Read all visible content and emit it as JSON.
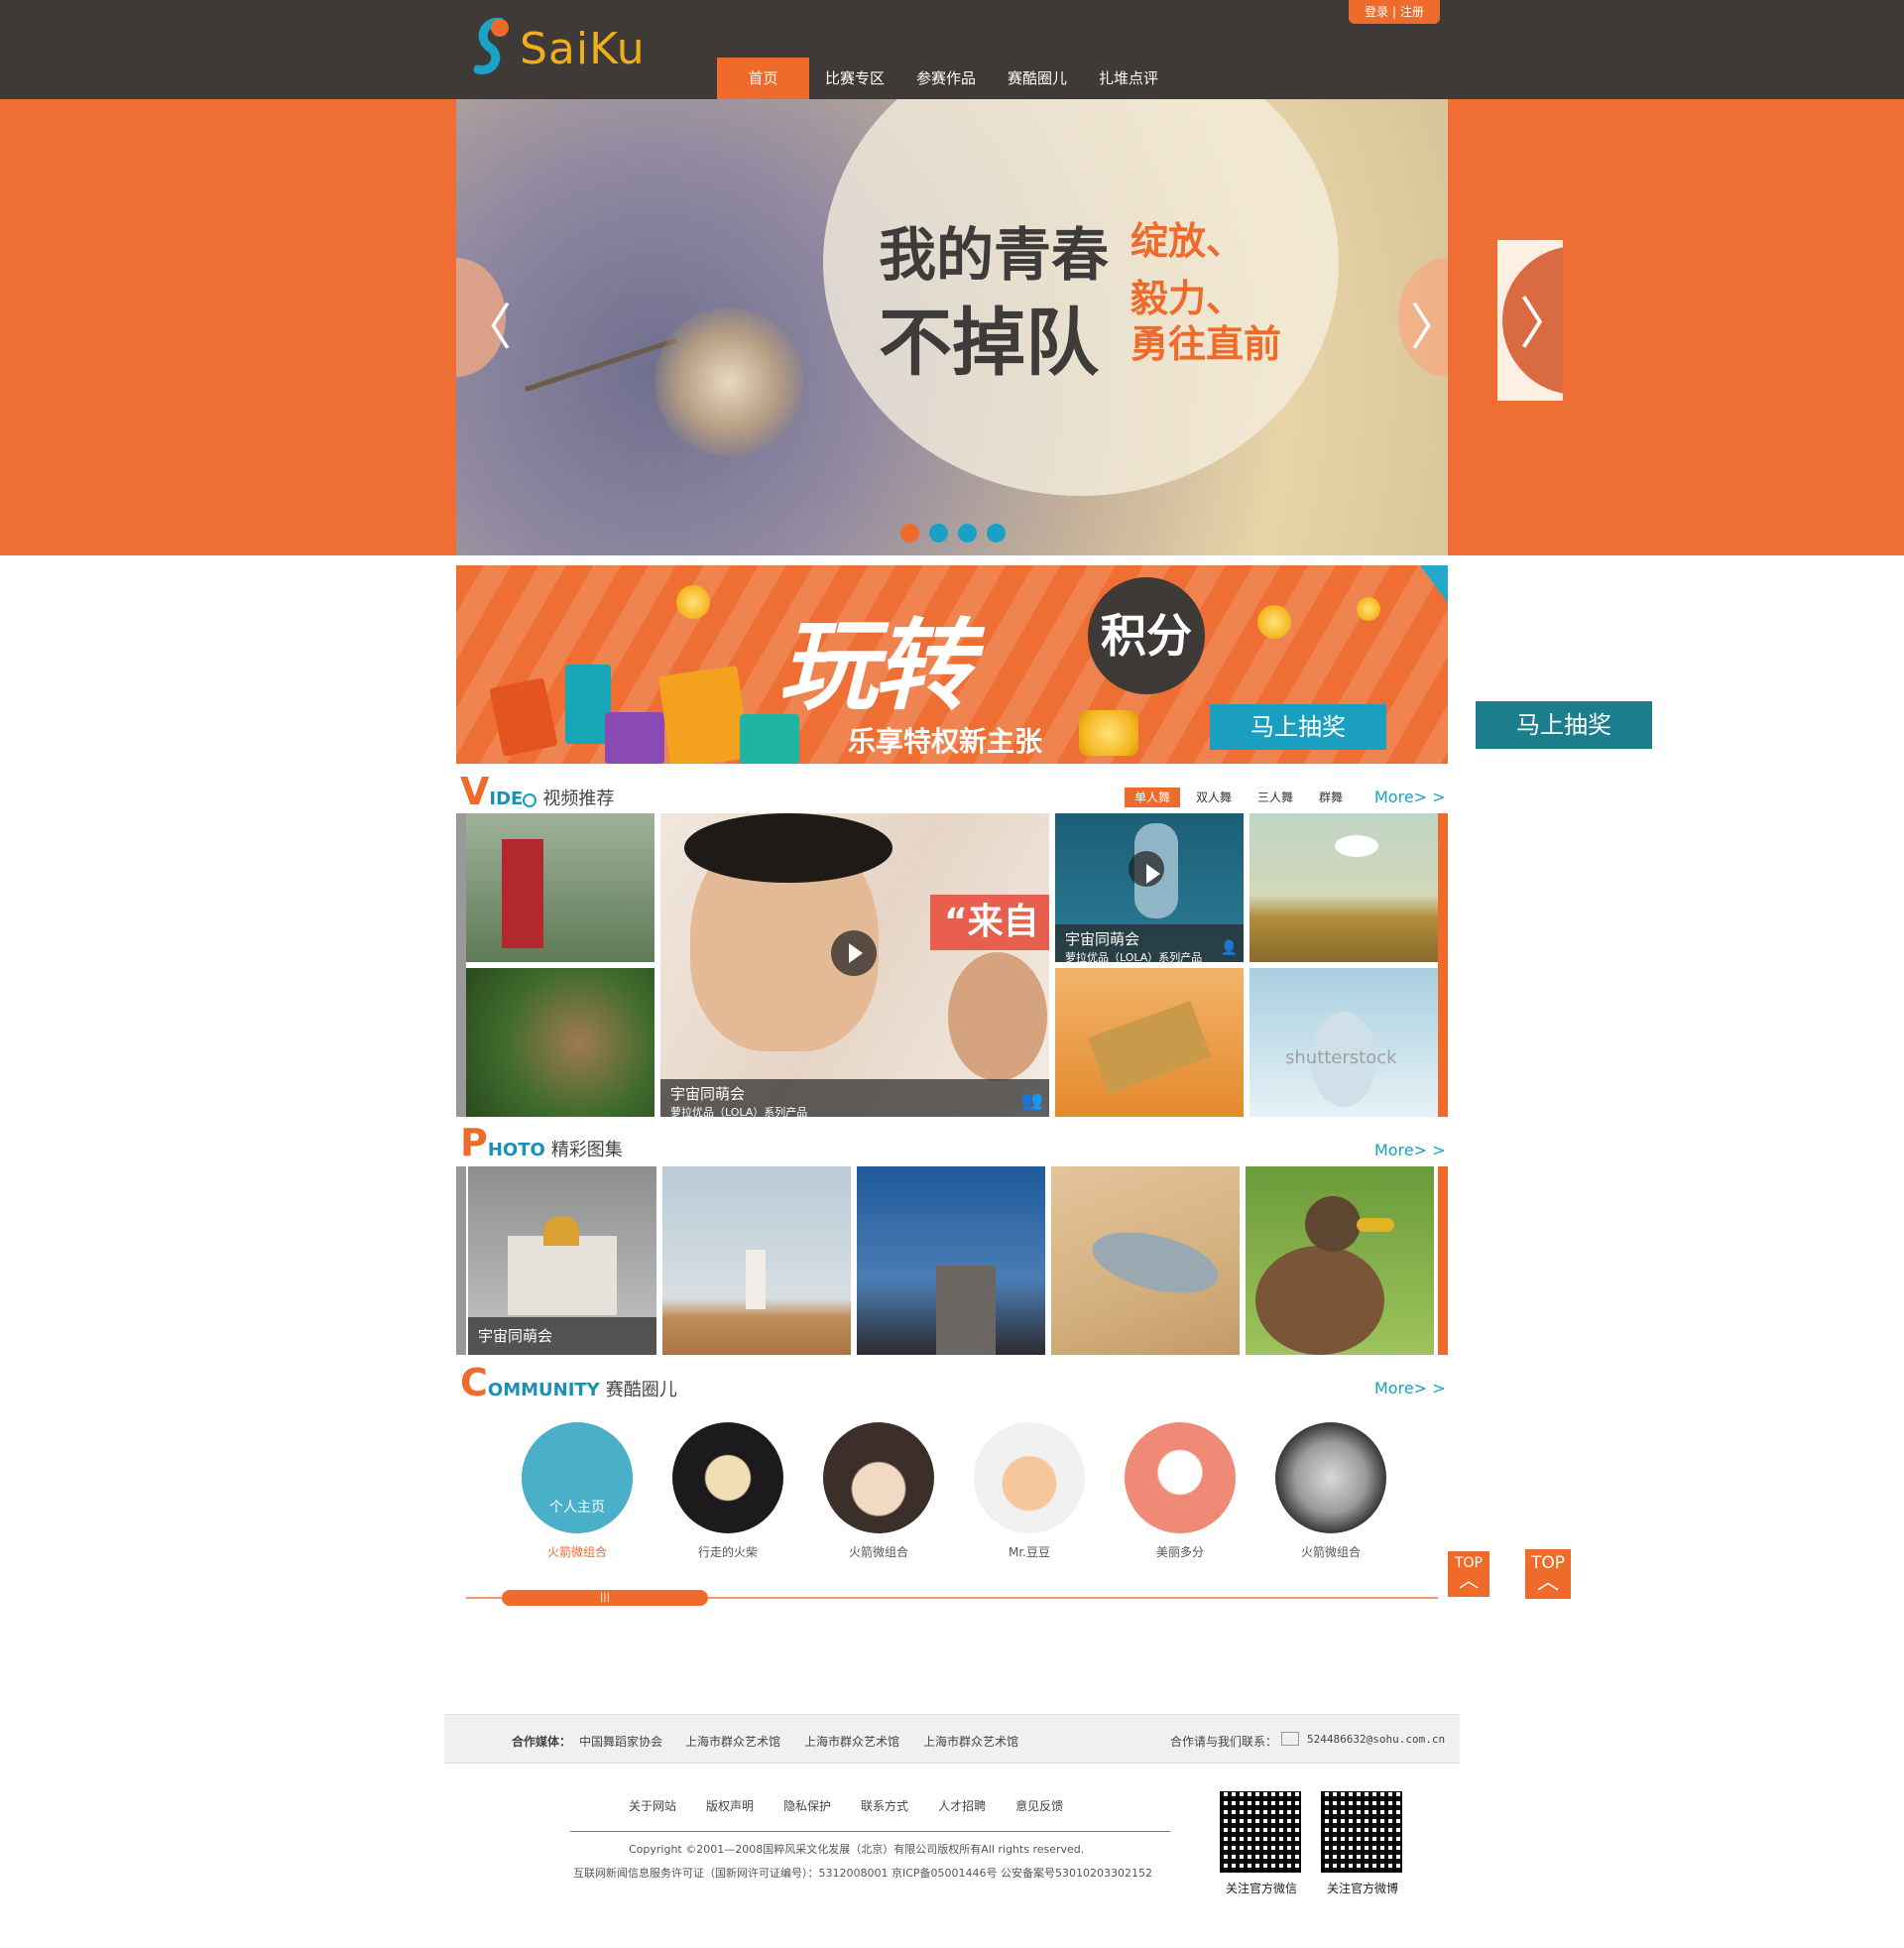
{
  "header": {
    "logo_text": "SaiKu",
    "login_label": "登录 | 注册",
    "nav": [
      "首页",
      "比赛专区",
      "参赛作品",
      "赛酷圈儿",
      "扎堆点评"
    ]
  },
  "hero": {
    "line1": "我的青春",
    "line2": "不掉队",
    "side": [
      "绽放、",
      "毅力、",
      "勇往直前"
    ],
    "prev_arrow": "〈",
    "next_arrow": "〉",
    "dots": 4,
    "active_dot": 1
  },
  "promo": {
    "title": "玩转",
    "bubble": "积分",
    "subtitle": "乐享特权新主张",
    "button": "马上抽奖"
  },
  "side_prize_button": "马上抽奖",
  "video": {
    "big_letter": "V",
    "rest": "IDE",
    "title_cn": "视频推荐",
    "tabs": [
      "单人舞",
      "双人舞",
      "三人舞",
      "群舞"
    ],
    "more": "More> >",
    "tiles": [
      {
        "title": "宇宙同萌会",
        "sub": "萝拉优品（LOLA）系列产品"
      },
      {
        "title": "宇宙同萌会",
        "sub": "萝拉优品（LOLA）系列产品"
      }
    ],
    "big_tile_overlay_text": "“来自",
    "watermark": "shutterstock"
  },
  "photo": {
    "big_letter": "P",
    "rest": "HOTO",
    "title_cn": "精彩图集",
    "more": "More> >",
    "caption": "宇宙同萌会"
  },
  "community": {
    "big_letter": "C",
    "rest": "OMMUNITY",
    "title_cn": "赛酷圈儿",
    "more": "More> >",
    "overlay": "个人主页",
    "members": [
      "火箭微组合",
      "行走的火柴",
      "火箭微组合",
      "Mr.豆豆",
      "美丽多分",
      "火箭微组合"
    ],
    "scroll_grip": "|||"
  },
  "top_label": "TOP",
  "footer": {
    "partners_label": "合作媒体：",
    "partners": [
      "中国舞蹈家协会",
      "上海市群众艺术馆",
      "上海市群众艺术馆",
      "上海市群众艺术馆"
    ],
    "contact_label": "合作请与我们联系：",
    "email": "524486632@sohu.com.cn",
    "links": [
      "关于网站",
      "版权声明",
      "隐私保护",
      "联系方式",
      "人才招聘",
      "意见反馈"
    ],
    "copyright": "Copyright ©2001—2008国粹风采文化发展（北京）有限公司版权所有All rights reserved.",
    "license": "互联网新闻信息服务许可证（国新网许可证编号）：5312008001 京ICP备05001446号 公安备案号53010203302152",
    "qr_labels": [
      "关注官方微信",
      "关注官方微博"
    ]
  },
  "colors": {
    "accent": "#ef6b2b",
    "header_bg": "#3d3a38",
    "link_blue": "#1b9fc1"
  }
}
